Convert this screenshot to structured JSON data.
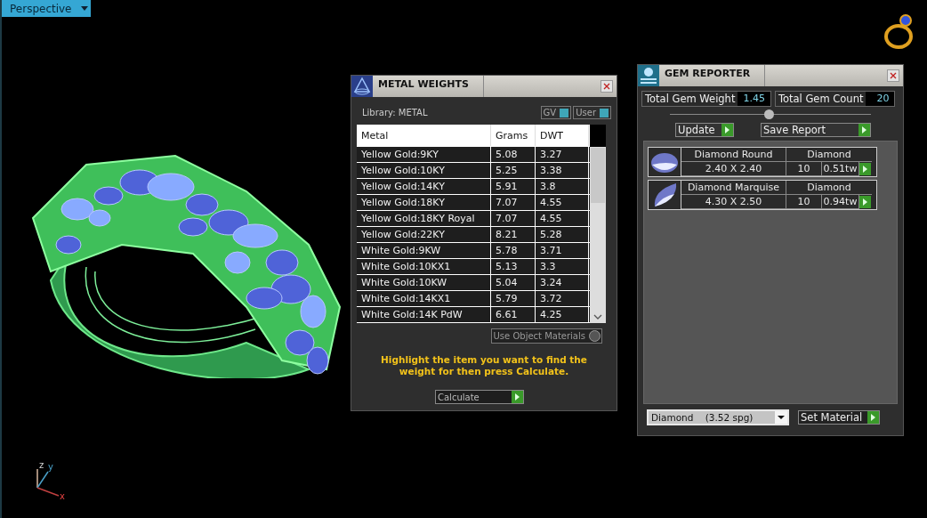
{
  "viewport": {
    "label": "Perspective",
    "axes": [
      "z",
      "y",
      "x"
    ]
  },
  "metal_weights": {
    "title": "METAL WEIGHTS",
    "library": "Library: METAL",
    "toggles": [
      {
        "label": "GV",
        "on": true
      },
      {
        "label": "User",
        "on": true
      }
    ],
    "columns": [
      "Metal",
      "Grams",
      "DWT"
    ],
    "rows": [
      {
        "metal": "Yellow Gold:9KY",
        "grams": "5.08",
        "dwt": "3.27"
      },
      {
        "metal": "Yellow Gold:10KY",
        "grams": "5.25",
        "dwt": "3.38"
      },
      {
        "metal": "Yellow Gold:14KY",
        "grams": "5.91",
        "dwt": "3.8"
      },
      {
        "metal": "Yellow Gold:18KY",
        "grams": "7.07",
        "dwt": "4.55"
      },
      {
        "metal": "Yellow Gold:18KY Royal",
        "grams": "7.07",
        "dwt": "4.55"
      },
      {
        "metal": "Yellow Gold:22KY",
        "grams": "8.21",
        "dwt": "5.28"
      },
      {
        "metal": "White Gold:9KW",
        "grams": "5.78",
        "dwt": "3.71"
      },
      {
        "metal": "White Gold:10KX1",
        "grams": "5.13",
        "dwt": "3.3"
      },
      {
        "metal": "White Gold:10KW",
        "grams": "5.04",
        "dwt": "3.24"
      },
      {
        "metal": "White Gold:14KX1",
        "grams": "5.79",
        "dwt": "3.72"
      },
      {
        "metal": "White Gold:14K PdW",
        "grams": "6.61",
        "dwt": "4.25"
      }
    ],
    "use_object_materials": {
      "label": "Use Object Materials",
      "on": false
    },
    "hint": "Highlight the item you want to find the weight for then press Calculate.",
    "calculate": "Calculate"
  },
  "gem_reporter": {
    "title": "GEM REPORTER",
    "totals": [
      {
        "label": "Total Gem Weight",
        "value": "1.45"
      },
      {
        "label": "Total Gem Count",
        "value": "20"
      }
    ],
    "buttons": [
      "Update",
      "Save Report"
    ],
    "gems": [
      {
        "kind": "round",
        "name": "Diamond Round",
        "material": "Diamond",
        "size": "2.40 X 2.40",
        "count": "10",
        "weight": "0.51tw"
      },
      {
        "kind": "marquise",
        "name": "Diamond Marquise",
        "material": "Diamond",
        "size": "4.30 X 2.50",
        "count": "10",
        "weight": "0.94tw"
      }
    ],
    "material": "Diamond    (3.52 spg)",
    "set_material": "Set Material"
  }
}
